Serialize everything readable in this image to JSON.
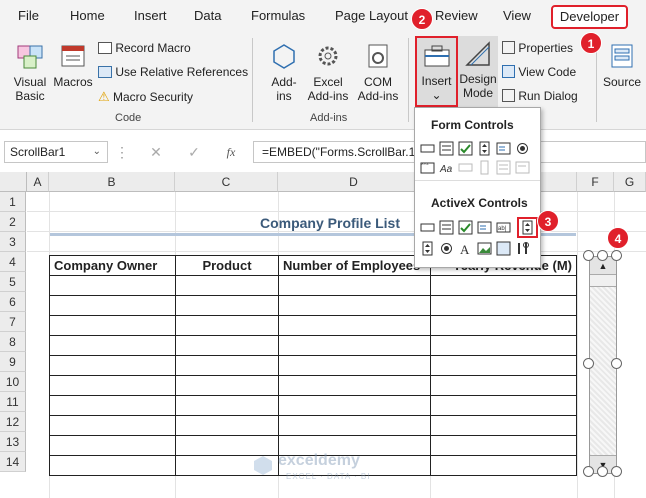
{
  "tabs": {
    "file": "File",
    "home": "Home",
    "insert": "Insert",
    "data": "Data",
    "formulas": "Formulas",
    "page_layout": "Page Layout",
    "review": "Review",
    "view": "View",
    "developer": "Developer"
  },
  "ribbon": {
    "visual_basic": "Visual\nBasic",
    "visual_basic_l1": "Visual",
    "visual_basic_l2": "Basic",
    "macros": "Macros",
    "record_macro": "Record Macro",
    "use_relative": "Use Relative References",
    "macro_security": "Macro Security",
    "group_code": "Code",
    "addins_l1": "Add-",
    "addins_l2": "ins",
    "excel_addins_l1": "Excel",
    "excel_addins_l2": "Add-ins",
    "com_addins_l1": "COM",
    "com_addins_l2": "Add-ins",
    "group_addins": "Add-ins",
    "insert_l1": "Insert",
    "insert_l2": "⌄",
    "design_l1": "Design",
    "design_l2": "Mode",
    "properties": "Properties",
    "view_code": "View Code",
    "run_dialog": "Run Dialog",
    "source": "Source"
  },
  "formula_bar": {
    "name_box": "ScrollBar1",
    "fx_label": "fx",
    "formula": "=EMBED(\"Forms.ScrollBar.1\",\"\")"
  },
  "columns": [
    "A",
    "B",
    "C",
    "D",
    "E",
    "F",
    "G"
  ],
  "rows": [
    "1",
    "2",
    "3",
    "4",
    "5",
    "6",
    "7",
    "8",
    "9",
    "10",
    "11",
    "12",
    "13",
    "14"
  ],
  "sheet": {
    "title": "Company Profile List",
    "headers": [
      "Company Owner",
      "Product",
      "Number of Employees",
      "Yearly Revenue (M)"
    ]
  },
  "insert_menu": {
    "form_controls": "Form Controls",
    "activex_controls": "ActiveX Controls"
  },
  "callouts": [
    "1",
    "2",
    "3",
    "4"
  ],
  "watermark": {
    "name": "exceldemy",
    "tagline": "EXCEL · DATA · BI"
  },
  "colors": {
    "accent_red": "#e0202b",
    "title_blue": "#3b5a7a",
    "ribbon_bg": "#f3f3f3"
  }
}
